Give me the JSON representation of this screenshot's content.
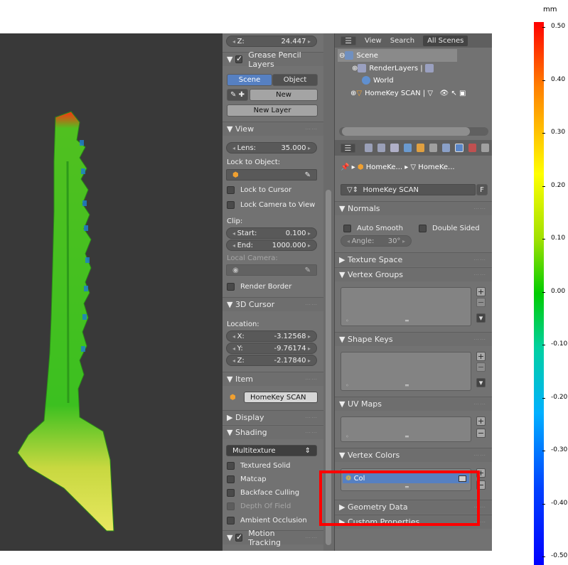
{
  "colorbar": {
    "unit": "mm",
    "ticks": [
      "0.50",
      "0.40",
      "0.30",
      "0.20",
      "0.10",
      "0.00",
      "-0.10",
      "-0.20",
      "-0.30",
      "-0.40",
      "-0.50"
    ],
    "colors": [
      "#ff0000",
      "#ffff00",
      "#00cc00",
      "#00b0ff",
      "#0000ff"
    ]
  },
  "left_panel": {
    "z_top": {
      "label": "Z:",
      "value": "24.447"
    },
    "grease_pencil": {
      "title": "Grease Pencil Layers",
      "tab_scene": "Scene",
      "tab_object": "Object",
      "new": "New",
      "new_layer": "New Layer"
    },
    "view": {
      "title": "View",
      "lens_label": "Lens:",
      "lens_value": "35.000",
      "lock_to_object": "Lock to Object:",
      "lock_to_cursor": "Lock to Cursor",
      "lock_camera": "Lock Camera to View",
      "clip": "Clip:",
      "start_label": "Start:",
      "start_value": "0.100",
      "end_label": "End:",
      "end_value": "1000.000",
      "local_camera": "Local Camera:",
      "render_border": "Render Border"
    },
    "cursor": {
      "title": "3D Cursor",
      "location": "Location:",
      "x_label": "X:",
      "x_value": "-3.12568",
      "y_label": "Y:",
      "y_value": "-9.76174",
      "z_label": "Z:",
      "z_value": "-2.17840"
    },
    "item": {
      "title": "Item",
      "name": "HomeKey SCAN"
    },
    "display": "Display",
    "shading": {
      "title": "Shading",
      "mode": "Multitexture",
      "textured_solid": "Textured Solid",
      "matcap": "Matcap",
      "backface_culling": "Backface Culling",
      "depth_of_field": "Depth Of Field",
      "ambient_occlusion": "Ambient Occlusion"
    },
    "motion_tracking": "Motion Tracking"
  },
  "outliner": {
    "view": "View",
    "search": "Search",
    "all_scenes": "All Scenes",
    "scene": "Scene",
    "render_layers": "RenderLayers",
    "world": "World",
    "object": "HomeKey SCAN"
  },
  "properties": {
    "breadcrumb_1": "HomeKe...",
    "breadcrumb_2": "HomeKe...",
    "mesh_name": "HomeKey SCAN",
    "fake_user": "F",
    "normals": {
      "title": "Normals",
      "auto_smooth": "Auto Smooth",
      "double_sided": "Double Sided",
      "angle_label": "Angle:",
      "angle_value": "30°"
    },
    "texture_space": "Texture Space",
    "vertex_groups": "Vertex Groups",
    "shape_keys": "Shape Keys",
    "uv_maps": "UV Maps",
    "vertex_colors": {
      "title": "Vertex Colors",
      "item": "Col"
    },
    "geometry_data": "Geometry Data",
    "custom_properties": "Custom Properties"
  }
}
